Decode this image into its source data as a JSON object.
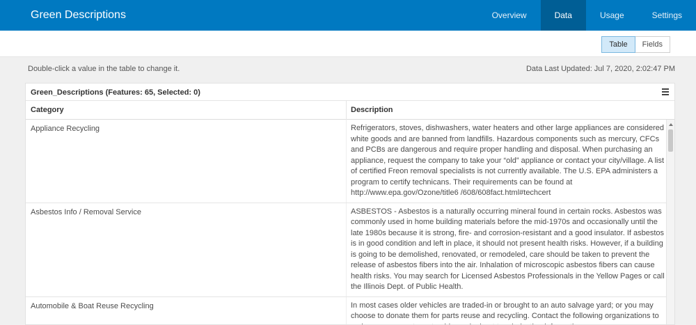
{
  "app": {
    "title": "Green Descriptions"
  },
  "nav": {
    "tabs": [
      {
        "label": "Overview",
        "active": false
      },
      {
        "label": "Data",
        "active": true
      },
      {
        "label": "Usage",
        "active": false
      },
      {
        "label": "Settings",
        "active": false
      }
    ]
  },
  "view_toggle": {
    "table_label": "Table",
    "fields_label": "Fields",
    "selected": "Table"
  },
  "hint": "Double-click a value in the table to change it.",
  "last_updated": "Data Last Updated: Jul 7, 2020, 2:02:47 PM",
  "table": {
    "title": "Green_Descriptions (Features: 65, Selected: 0)",
    "columns": [
      "Category",
      "Description"
    ],
    "rows": [
      {
        "category": "Appliance Recycling",
        "description": "Refrigerators, stoves, dishwashers, water heaters and other large appliances are considered white goods and are banned from landfills. Hazardous components such as mercury, CFCs and PCBs are dangerous and require proper handling and disposal. When purchasing an appliance, request the company to take your “old” appliance or contact your city/village. A list of certified Freon removal specialists is not currently available. The U.S. EPA administers a program to certify technicans. Their requirements can be found at http://www.epa.gov/Ozone/title6 /608/608fact.html#techcert"
      },
      {
        "category": "Asbestos Info / Removal Service",
        "description": "ASBESTOS - Asbestos is a naturally occurring mineral found in certain rocks. Asbestos was commonly used in home building materials before the mid-1970s and occasionally until the late 1980s because it is strong, fire- and corrosion-resistant and a good insulator. If asbestos is in good condition and left in place, it should not present health risks. However, if a building is going to be demolished, renovated, or remodeled, care should be taken to prevent the release of asbestos fibers into the air. Inhalation of microscopic asbestos fibers can cause health risks. You may search for Licensed Asbestos Professionals in the Yellow Pages or call the Illinois Dept. of Public Health."
      },
      {
        "category": "Automobile & Boat Reuse Recycling",
        "description": "In most cases older vehicles are traded-in or brought to an auto salvage yard; or you may choose to donate them for parts reuse and recycling. Contact the following organizations to make arrangements, get paid or ask about tax deduction information."
      }
    ]
  },
  "colors": {
    "header": "#0079c1",
    "active_tab": "#005e95",
    "toggle_active": "#d2e9f9"
  }
}
